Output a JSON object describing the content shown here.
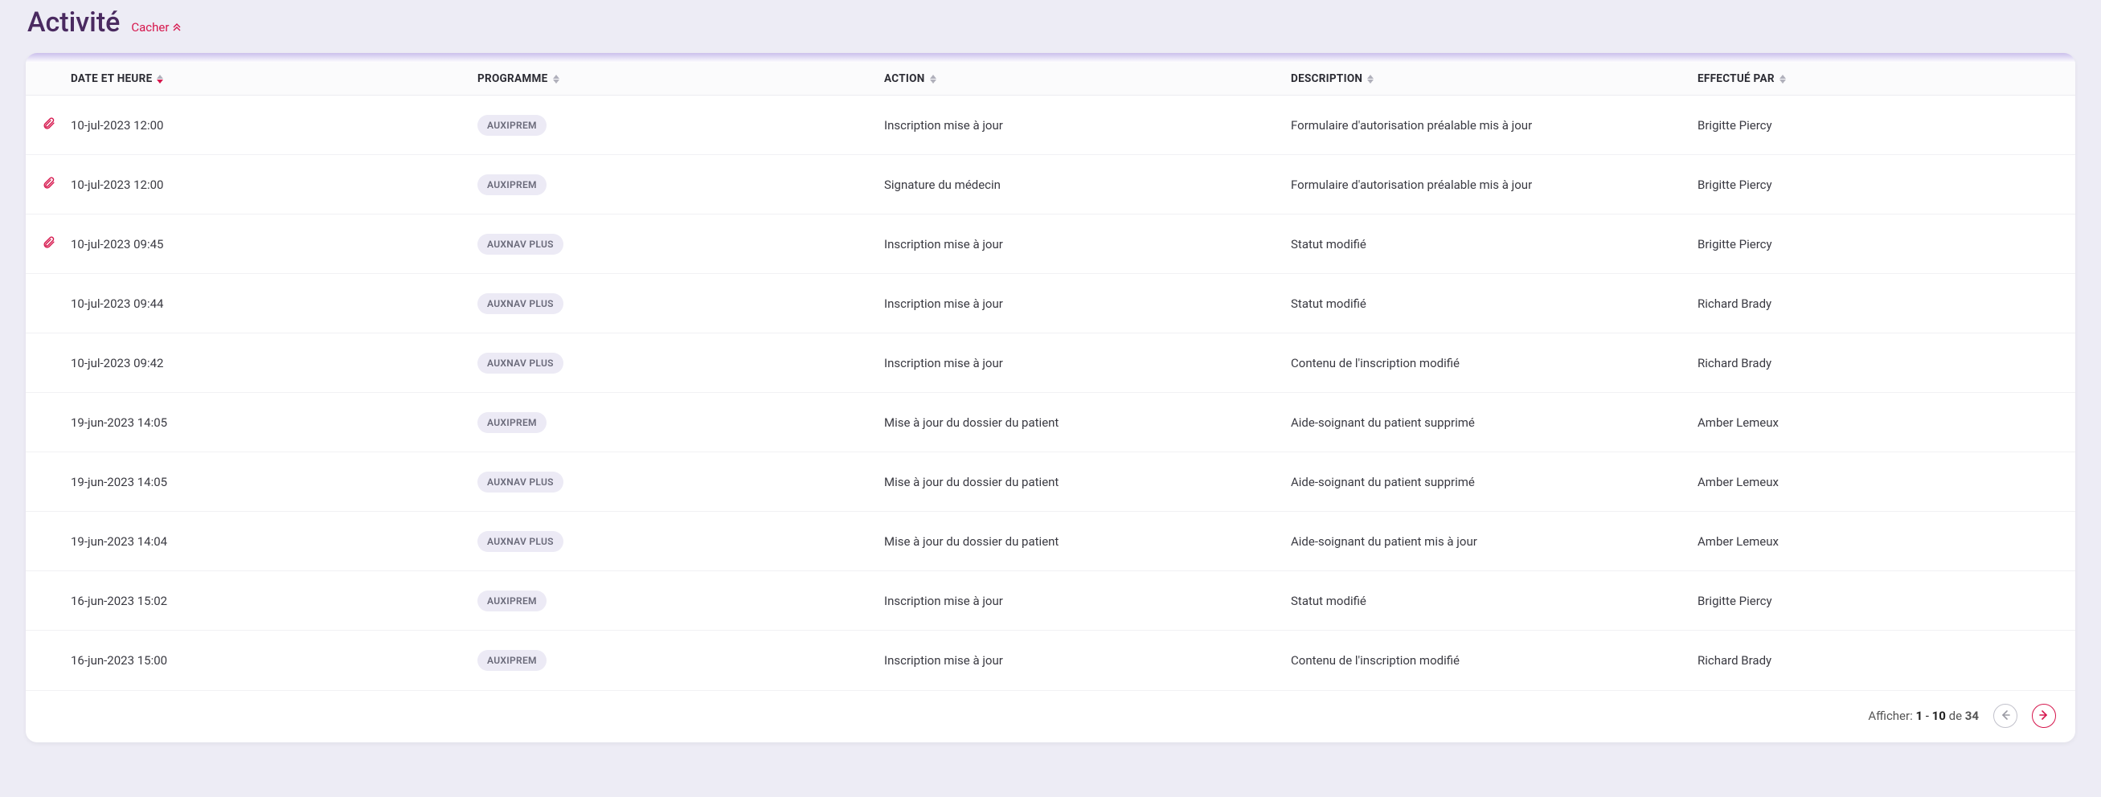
{
  "header": {
    "title": "Activité",
    "hide_label": "Cacher"
  },
  "columns": {
    "date": "DATE ET HEURE",
    "programme": "PROGRAMME",
    "action": "ACTION",
    "description": "DESCRIPTION",
    "performed_by": "EFFECTUÉ PAR"
  },
  "rows": [
    {
      "attach": true,
      "date": "10-jul-2023 12:00",
      "programme": "AUXIPREM",
      "action": "Inscription mise à jour",
      "description": "Formulaire d'autorisation préalable mis à jour",
      "performed_by": "Brigitte Piercy"
    },
    {
      "attach": true,
      "date": "10-jul-2023 12:00",
      "programme": "AUXIPREM",
      "action": "Signature du médecin",
      "description": "Formulaire d'autorisation préalable mis à jour",
      "performed_by": "Brigitte Piercy"
    },
    {
      "attach": true,
      "date": "10-jul-2023 09:45",
      "programme": "AUXNAV PLUS",
      "action": "Inscription mise à jour",
      "description": "Statut modifié",
      "performed_by": "Brigitte Piercy"
    },
    {
      "attach": false,
      "date": "10-jul-2023 09:44",
      "programme": "AUXNAV PLUS",
      "action": "Inscription mise à jour",
      "description": "Statut modifié",
      "performed_by": "Richard Brady"
    },
    {
      "attach": false,
      "date": "10-jul-2023 09:42",
      "programme": "AUXNAV PLUS",
      "action": "Inscription mise à jour",
      "description": "Contenu de l'inscription modifié",
      "performed_by": "Richard Brady"
    },
    {
      "attach": false,
      "date": "19-jun-2023 14:05",
      "programme": "AUXIPREM",
      "action": "Mise à jour du dossier du patient",
      "description": "Aide-soignant du patient supprimé",
      "performed_by": "Amber Lemeux"
    },
    {
      "attach": false,
      "date": "19-jun-2023 14:05",
      "programme": "AUXNAV PLUS",
      "action": "Mise à jour du dossier du patient",
      "description": "Aide-soignant du patient supprimé",
      "performed_by": "Amber Lemeux"
    },
    {
      "attach": false,
      "date": "19-jun-2023 14:04",
      "programme": "AUXNAV PLUS",
      "action": "Mise à jour du dossier du patient",
      "description": "Aide-soignant du patient mis à jour",
      "performed_by": "Amber Lemeux"
    },
    {
      "attach": false,
      "date": "16-jun-2023 15:02",
      "programme": "AUXIPREM",
      "action": "Inscription mise à jour",
      "description": "Statut modifié",
      "performed_by": "Brigitte Piercy"
    },
    {
      "attach": false,
      "date": "16-jun-2023 15:00",
      "programme": "AUXIPREM",
      "action": "Inscription mise à jour",
      "description": "Contenu de l'inscription modifié",
      "performed_by": "Richard Brady"
    }
  ],
  "pagination": {
    "display_label": "Afficher:",
    "from": "1",
    "to": "10",
    "of_label": "de",
    "total": "34"
  },
  "colors": {
    "accent": "#d6174d",
    "title": "#4a2a60"
  }
}
